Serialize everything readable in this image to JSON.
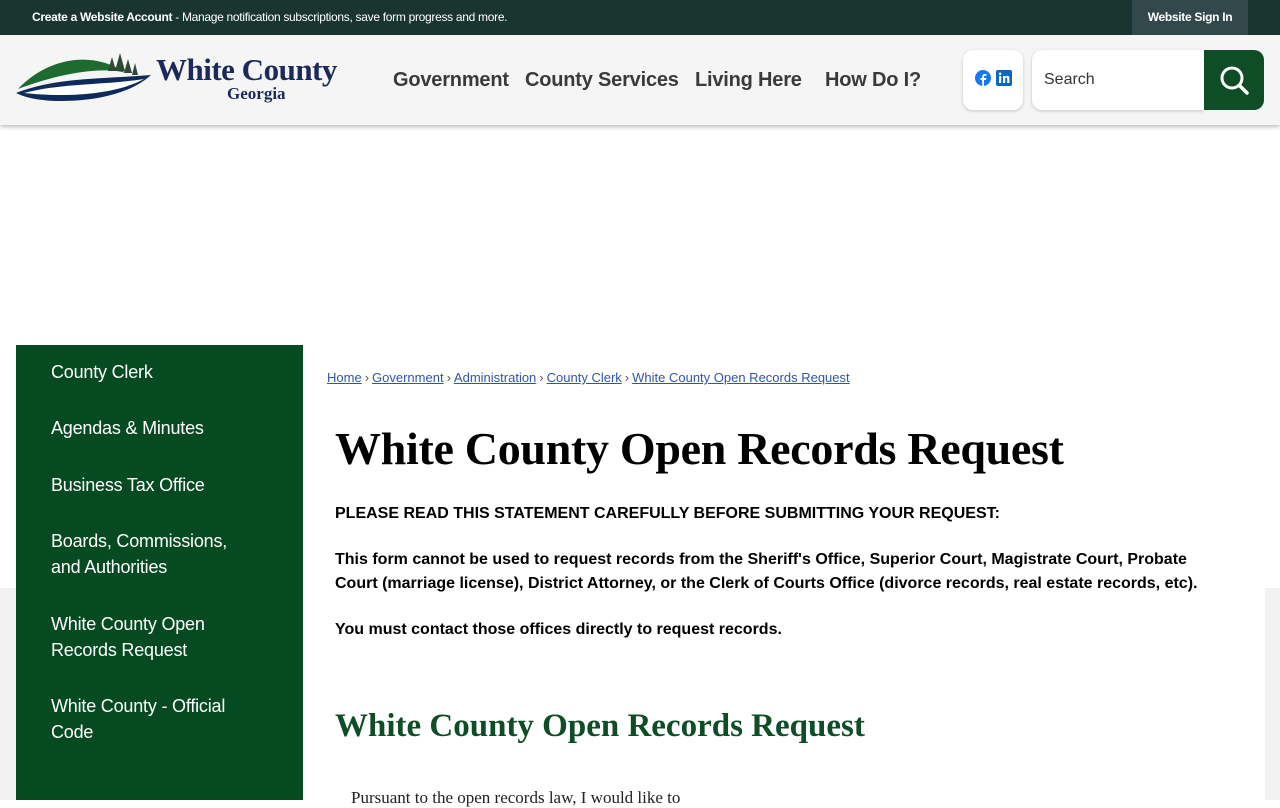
{
  "topbar": {
    "create_account": "Create a Website Account",
    "create_account_desc": " - Manage notification subscriptions, save form progress and more.",
    "sign_in": "Website Sign In"
  },
  "logo": {
    "title": "White County",
    "subtitle": "Georgia"
  },
  "nav": {
    "government": "Government",
    "county_services": "County Services",
    "living_here": "Living Here",
    "how_do_i": "How Do I?"
  },
  "search": {
    "placeholder": "Search"
  },
  "sidebar": {
    "items": [
      {
        "label": "County Clerk"
      },
      {
        "label": "Agendas & Minutes"
      },
      {
        "label": "Business Tax Office"
      },
      {
        "label": "Boards, Commissions, and Authorities"
      },
      {
        "label": "White County Open Records Request"
      },
      {
        "label": "White County - Official Code"
      }
    ]
  },
  "breadcrumb": {
    "items": [
      {
        "label": "Home"
      },
      {
        "label": "Government"
      },
      {
        "label": "Administration"
      },
      {
        "label": "County Clerk"
      },
      {
        "label": "White County Open Records Request"
      }
    ],
    "separator": "›"
  },
  "main": {
    "title": "White County Open Records Request",
    "statement_heading": " PLEASE READ THIS STATEMENT CAREFULLY BEFORE SUBMITTING YOUR REQUEST:",
    "statement_body": " This form cannot be used to request records from the Sheriff's Office, Superior Court, Magistrate Court, Probate Court (marriage license), District Attorney, or the Clerk of Courts Office (divorce records, real estate records, etc).",
    "statement_contact": " You must contact those offices directly to request records.",
    "form_title": "White County Open Records Request",
    "form_lead": "Pursuant to the open records law, I would like to"
  },
  "colors": {
    "topbar": "#1a3530",
    "brand_green": "#0e4d26",
    "sidebar": "#064a22",
    "link": "#2f56a6"
  },
  "icons": [
    "facebook-icon",
    "linkedin-icon",
    "search-icon"
  ]
}
